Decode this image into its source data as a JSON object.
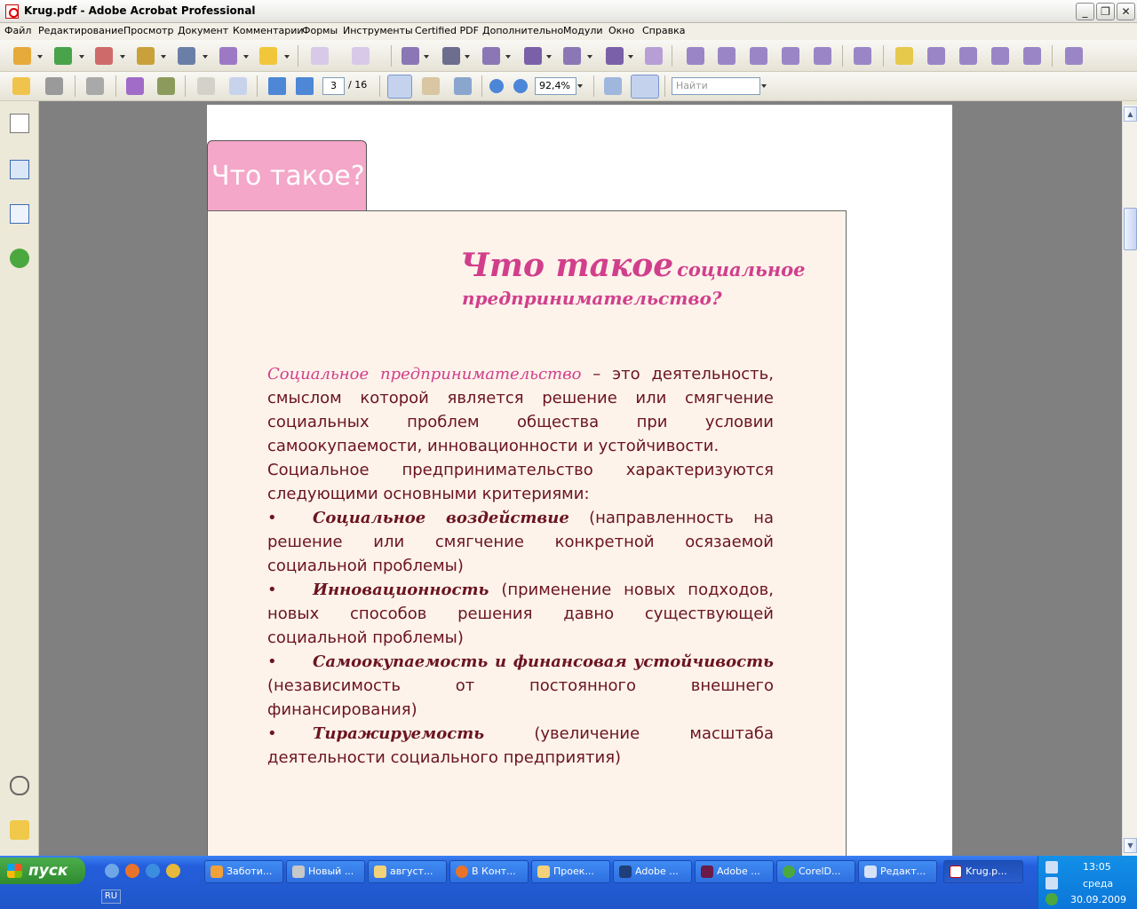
{
  "window": {
    "title": "Krug.pdf - Adobe Acrobat Professional"
  },
  "menu": [
    "Файл",
    "Редактирование",
    "Просмотр",
    "Документ",
    "Комментарии",
    "Формы",
    "Инструменты",
    "Certified PDF",
    "Дополнительно",
    "Модули",
    "Окно",
    "Справка"
  ],
  "toolbar": {
    "page_current": "3",
    "page_total": "/ 16",
    "zoom": "92,4%",
    "search_placeholder": "Найти"
  },
  "document": {
    "tab_label": "Что такое?",
    "heading_big": "Что такое",
    "heading_small": "социальное",
    "heading_line2": "предпринимательство?",
    "intro_term": "Социальное предпринимательство",
    "intro_rest": " – это деятельность, смыслом которой является решение или смягчение социальных проблем общества при условии самоокупаемости, инновационности и устойчивости.",
    "criteria_intro": "Социальное предпринимательство характеризуются следующими основными критериями:",
    "criteria": [
      {
        "name": "Социальное воздействие",
        "desc": " (направленность на решение или смягчение конкретной осязаемой социальной проблемы)"
      },
      {
        "name": "Инновационность",
        "desc": " (применение новых подходов, новых способов решения давно существующей социальной проблемы)"
      },
      {
        "name": "Самоокупаемость и финансовая устойчивость",
        "desc": " (независимость от постоянного внешнего финансирования)"
      },
      {
        "name": "Тиражируемость",
        "desc": " (увеличение масштаба деятельности социального предприятия)"
      }
    ],
    "bullet": "•"
  },
  "taskbar": {
    "start": "пуск",
    "tasks": [
      "Заботи...",
      "Новый ...",
      "август...",
      "В Конт...",
      "Проек...",
      "Adobe ...",
      "Adobe ...",
      "CorelD...",
      "Редакт...",
      "Krug.p..."
    ],
    "lang": "RU",
    "time": "13:05",
    "day": "среда",
    "date": "30.09.2009"
  },
  "colors": {
    "accent_pink": "#d13f8c",
    "tab_pink": "#f4a7c8",
    "text_maroon": "#6b1420",
    "page_bg": "#fdf3ea"
  }
}
